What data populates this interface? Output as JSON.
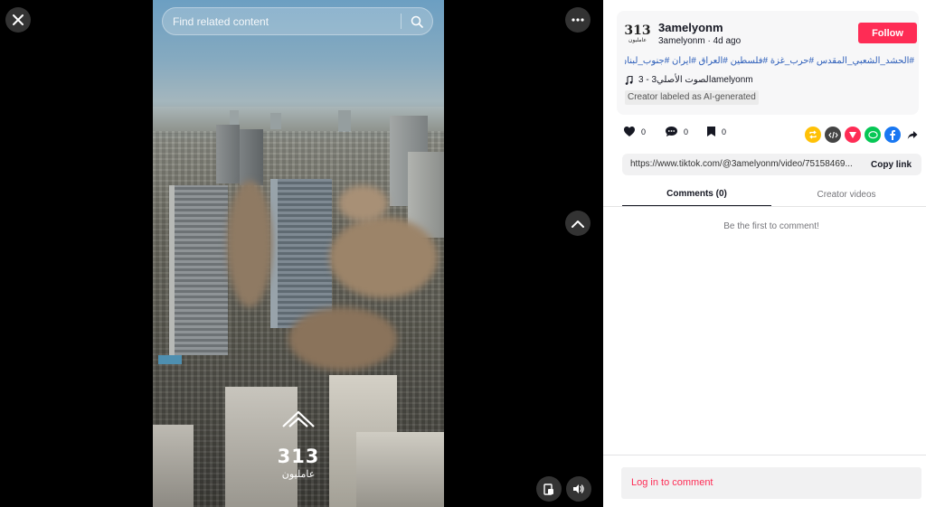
{
  "search": {
    "placeholder": "Find related content"
  },
  "watermark": {
    "number": "313",
    "name": "عامليون"
  },
  "author": {
    "avatar_text": "313",
    "avatar_sub": "عامليون",
    "username": "3amelyonm",
    "handle": "3amelyonm",
    "posted": "4d ago",
    "follow_label": "Follow"
  },
  "post": {
    "hashtags": "#الحشد_الشعبي_المقدس #حرب_غزة #فلسطين #العراق #ايران #جنوب_لبنان",
    "sound": "3 - الصوت الأصلي3amelyonm",
    "ai_label": "Creator labeled as AI-generated"
  },
  "stats": {
    "likes": "0",
    "comments": "0",
    "saves": "0"
  },
  "share": {
    "link": "https://www.tiktok.com/@3amelyonm/video/75158469...",
    "copy_label": "Copy link"
  },
  "tabs": [
    {
      "label": "Comments (0)",
      "active": true
    },
    {
      "label": "Creator videos",
      "active": false
    }
  ],
  "comments": {
    "empty_text": "Be the first to comment!"
  },
  "login": {
    "label": "Log in to comment"
  },
  "colors": {
    "brand": "#fe2c55",
    "hashtag": "#2b5db9",
    "repost": "#ffc107",
    "embed": "#444444",
    "direct": "#fe2c55",
    "line": "#06c755",
    "facebook": "#1877f2"
  },
  "icons": {
    "close": "close-icon",
    "more": "more-icon",
    "search": "search-icon",
    "up": "chevron-up-icon",
    "pip": "picture-in-picture-icon",
    "volume": "volume-icon",
    "like": "heart-icon",
    "comment": "comment-icon",
    "save": "bookmark-icon",
    "share_options": [
      "repost-icon",
      "embed-icon",
      "send-icon",
      "line-icon",
      "facebook-icon",
      "share-arrow-icon"
    ]
  }
}
